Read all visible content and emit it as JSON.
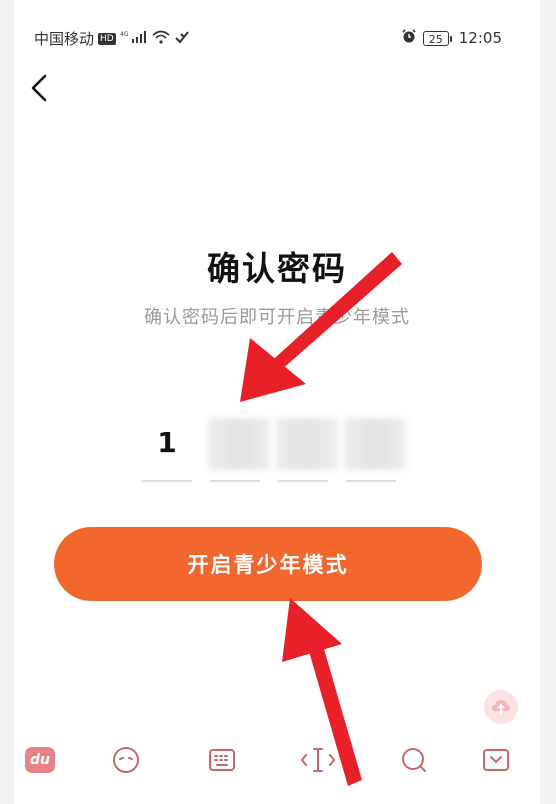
{
  "status_bar": {
    "carrier": "中国移动",
    "hd": "HD",
    "network": "4G",
    "battery": "25",
    "time": "12:05"
  },
  "page": {
    "title": "确认密码",
    "subtitle": "确认密码后即可开启青少年模式"
  },
  "pin": {
    "digits": [
      "1",
      "",
      "",
      ""
    ]
  },
  "primary_button": {
    "label": "开启青少年模式"
  },
  "keyboard_toolbar": {
    "logo_text": "du"
  },
  "colors": {
    "accent": "#f2672e",
    "arrow": "#e8202a"
  }
}
